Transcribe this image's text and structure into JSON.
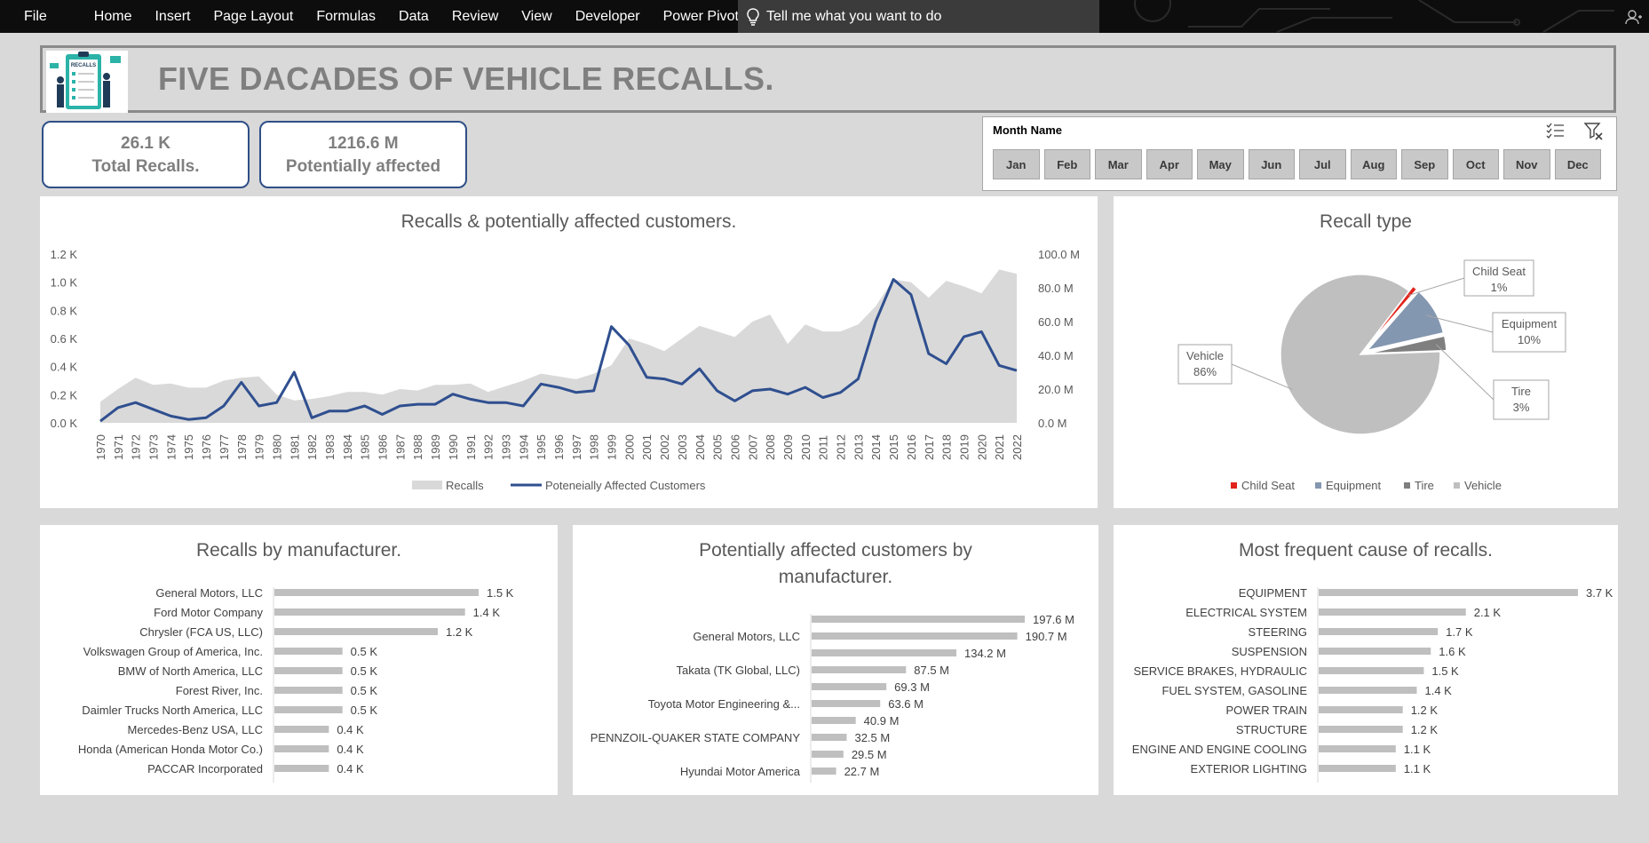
{
  "ribbon": {
    "file": "File",
    "tabs": [
      "Home",
      "Insert",
      "Page Layout",
      "Formulas",
      "Data",
      "Review",
      "View",
      "Developer",
      "Power Pivot"
    ],
    "tell_me": "Tell me what you want to do"
  },
  "banner": {
    "title": "FIVE DACADES OF VEHICLE RECALLS.",
    "logo_text": "RECALLS"
  },
  "kpis": [
    {
      "value": "26.1 K",
      "label": "Total Recalls."
    },
    {
      "value": "1216.6 M",
      "label": "Potentially affected"
    }
  ],
  "slicer": {
    "title": "Month Name",
    "months": [
      "Jan",
      "Feb",
      "Mar",
      "Apr",
      "May",
      "Jun",
      "Jul",
      "Aug",
      "Sep",
      "Oct",
      "Nov",
      "Dec"
    ]
  },
  "panels": {
    "trend_title": "Recalls & potentially affected customers.",
    "type_title": "Recall type",
    "manufacturer_title": "Recalls by manufacturer.",
    "affected_title_line1": "Potentially affected customers by",
    "affected_title_line2": "manufacturer.",
    "cause_title": "Most frequent cause of recalls."
  },
  "chart_data": [
    {
      "type": "area",
      "title": "Recalls & potentially affected customers.",
      "x": [
        1970,
        1971,
        1972,
        1973,
        1974,
        1975,
        1976,
        1977,
        1978,
        1979,
        1980,
        1981,
        1982,
        1983,
        1984,
        1985,
        1986,
        1987,
        1988,
        1989,
        1990,
        1991,
        1992,
        1993,
        1994,
        1995,
        1996,
        1997,
        1998,
        1999,
        2000,
        2001,
        2002,
        2003,
        2004,
        2005,
        2006,
        2007,
        2008,
        2009,
        2010,
        2011,
        2012,
        2013,
        2014,
        2015,
        2016,
        2017,
        2018,
        2019,
        2020,
        2021,
        2022
      ],
      "y_left_ticks": [
        "0.0 K",
        "0.2 K",
        "0.4 K",
        "0.6 K",
        "0.8 K",
        "1.0 K",
        "1.2 K"
      ],
      "y_right_ticks": [
        "0.0 M",
        "20.0 M",
        "40.0 M",
        "60.0 M",
        "80.0 M",
        "100.0 M"
      ],
      "ylim_left": [
        0,
        1200
      ],
      "ylim_right": [
        0,
        100
      ],
      "legend_position": "bottom",
      "series": [
        {
          "name": "Recalls",
          "axis": "left",
          "color": "#d9d9d9",
          "values": [
            150,
            240,
            320,
            270,
            280,
            250,
            250,
            300,
            320,
            330,
            200,
            160,
            170,
            190,
            220,
            220,
            200,
            240,
            230,
            270,
            270,
            280,
            220,
            260,
            300,
            350,
            330,
            310,
            350,
            410,
            600,
            560,
            510,
            600,
            690,
            650,
            610,
            720,
            770,
            560,
            700,
            650,
            650,
            700,
            830,
            1020,
            1000,
            890,
            1010,
            970,
            920,
            1090,
            1060
          ]
        },
        {
          "name": "Poteneially Affected Customers",
          "axis": "right",
          "color": "#2f4f8f",
          "values": [
            1,
            9,
            12,
            8,
            4,
            2,
            3,
            10,
            24,
            10,
            12,
            30,
            3,
            7,
            7,
            10,
            5,
            10,
            11,
            11,
            17,
            14,
            12,
            12,
            10,
            23,
            21,
            18,
            19,
            57,
            46,
            27,
            26,
            23,
            32,
            19,
            13,
            19,
            20,
            17,
            21,
            15,
            18,
            26,
            60,
            85,
            76,
            41,
            35,
            51,
            54,
            34,
            31
          ]
        }
      ]
    },
    {
      "type": "pie",
      "title": "Recall type",
      "categories": [
        "Child Seat",
        "Equipment",
        "Tire",
        "Vehicle"
      ],
      "values": [
        1,
        10,
        3,
        86
      ],
      "labels": [
        "1%",
        "10%",
        "3%",
        "86%"
      ],
      "colors": [
        "#e2231a",
        "#8497b0",
        "#7f7f7f",
        "#bfbfbf"
      ],
      "legend_position": "bottom"
    },
    {
      "type": "bar",
      "title": "Recalls by manufacturer.",
      "categories": [
        "General Motors, LLC",
        "Ford Motor Company",
        "Chrysler (FCA US, LLC)",
        "Volkswagen Group of America, Inc.",
        "BMW of North America, LLC",
        "Forest River, Inc.",
        "Daimler Trucks North America, LLC",
        "Mercedes-Benz USA, LLC",
        "Honda (American Honda Motor Co.)",
        "PACCAR Incorporated"
      ],
      "values": [
        1.5,
        1.4,
        1.2,
        0.5,
        0.5,
        0.5,
        0.5,
        0.4,
        0.4,
        0.4
      ],
      "data_labels": [
        "1.5 K",
        "1.4 K",
        "1.2 K",
        "0.5 K",
        "0.5 K",
        "0.5 K",
        "0.5 K",
        "0.4 K",
        "0.4 K",
        "0.4 K"
      ],
      "color": "#bfbfbf"
    },
    {
      "type": "bar",
      "title": "Potentially affected customers by manufacturer.",
      "categories": [
        "",
        "General Motors, LLC",
        "",
        "Takata (TK Global, LLC)",
        "",
        "Toyota Motor Engineering &...",
        "",
        "PENNZOIL-QUAKER STATE COMPANY",
        "",
        "Hyundai Motor America"
      ],
      "values": [
        197.6,
        190.7,
        134.2,
        87.5,
        69.3,
        63.6,
        40.9,
        32.5,
        29.5,
        22.7
      ],
      "data_labels": [
        "197.6 M",
        "190.7 M",
        "134.2 M",
        "87.5 M",
        "69.3 M",
        "63.6 M",
        "40.9 M",
        "32.5 M",
        "29.5 M",
        "22.7 M"
      ],
      "color": "#bfbfbf"
    },
    {
      "type": "bar",
      "title": "Most frequent cause of recalls.",
      "categories": [
        "EQUIPMENT",
        "ELECTRICAL SYSTEM",
        "STEERING",
        "SUSPENSION",
        "SERVICE BRAKES, HYDRAULIC",
        "FUEL SYSTEM, GASOLINE",
        "POWER TRAIN",
        "STRUCTURE",
        "ENGINE AND ENGINE COOLING",
        "EXTERIOR LIGHTING"
      ],
      "values": [
        3.7,
        2.1,
        1.7,
        1.6,
        1.5,
        1.4,
        1.2,
        1.2,
        1.1,
        1.1
      ],
      "data_labels": [
        "3.7 K",
        "2.1 K",
        "1.7 K",
        "1.6 K",
        "1.5 K",
        "1.4 K",
        "1.2 K",
        "1.2 K",
        "1.1 K",
        "1.1 K"
      ],
      "color": "#bfbfbf"
    }
  ]
}
